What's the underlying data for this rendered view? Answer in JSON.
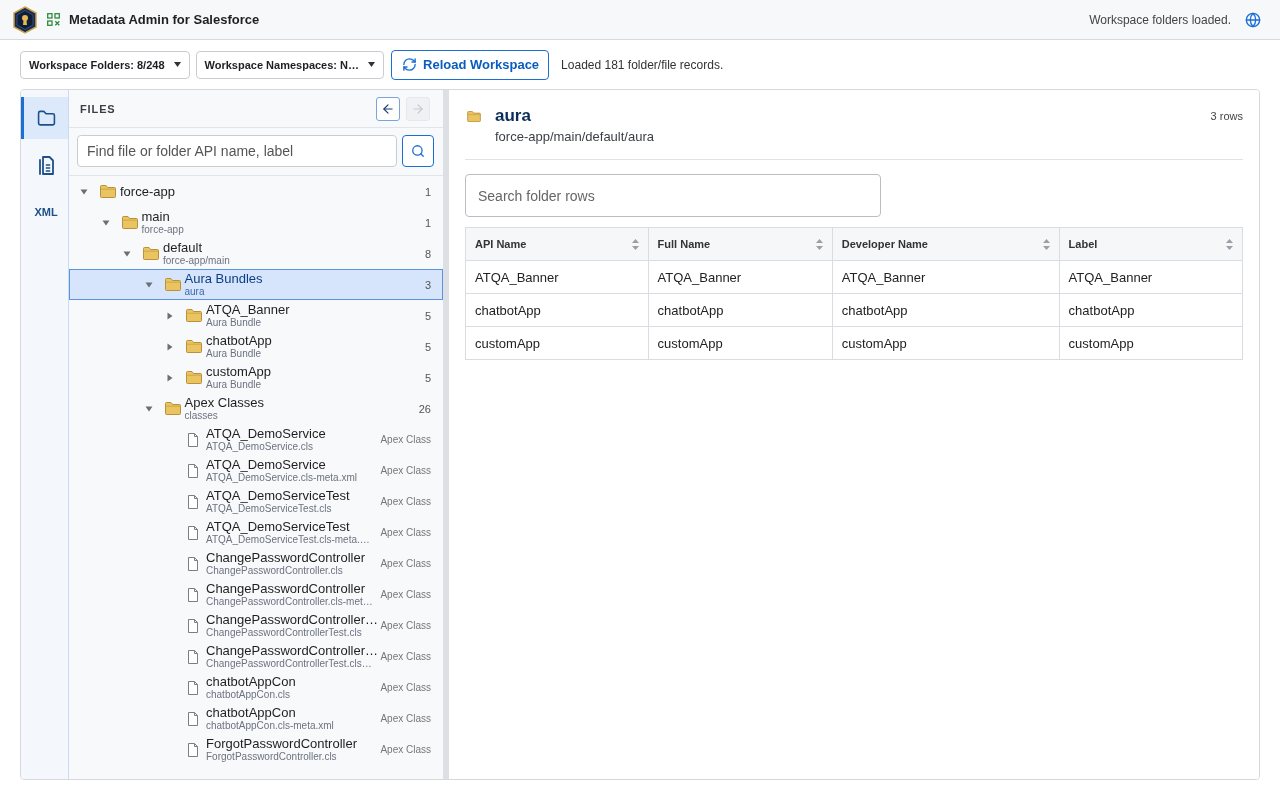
{
  "app_header": {
    "title": "Metadata Admin for Salesforce",
    "status": "Workspace folders loaded."
  },
  "toolbar": {
    "dropdowns": [
      {
        "label": "Workspace Folders: 8/248"
      },
      {
        "label": "Workspace Namespaces: N…"
      }
    ],
    "reload_button": {
      "label": "Reload Workspace"
    },
    "status": "Loaded 181 folder/file records."
  },
  "rail": [
    {
      "kind": "folder",
      "selected": true
    },
    {
      "kind": "document",
      "selected": false
    },
    {
      "kind": "label",
      "label": "XML",
      "selected": false
    }
  ],
  "files_panel": {
    "title": "FILES",
    "nav_buttons": [
      {
        "kind": "back",
        "disabled": false
      },
      {
        "kind": "forward",
        "disabled": true
      }
    ],
    "search": {
      "placeholder": "Find file or folder API name, label"
    },
    "tree": [
      {
        "kind": "folder",
        "name": "force-app",
        "count": "1",
        "expanded": true,
        "selected": false,
        "children": [
          {
            "kind": "folder",
            "name": "main",
            "subtitle": "force-app",
            "count": "1",
            "expanded": true,
            "selected": false,
            "children": [
              {
                "kind": "folder",
                "name": "default",
                "subtitle": "force-app/main",
                "count": "8",
                "expanded": true,
                "selected": false,
                "children": [
                  {
                    "kind": "folder",
                    "name": "Aura Bundles",
                    "subtitle": "aura",
                    "count": "3",
                    "expanded": true,
                    "selected": true,
                    "children": [
                      {
                        "kind": "folder",
                        "name": "ATQA_Banner",
                        "subtitle": "Aura Bundle",
                        "count": "5",
                        "expanded": false,
                        "selected": false
                      },
                      {
                        "kind": "folder",
                        "name": "chatbotApp",
                        "subtitle": "Aura Bundle",
                        "count": "5",
                        "expanded": false,
                        "selected": false
                      },
                      {
                        "kind": "folder",
                        "name": "customApp",
                        "subtitle": "Aura Bundle",
                        "count": "5",
                        "expanded": false,
                        "selected": false
                      }
                    ]
                  },
                  {
                    "kind": "folder",
                    "name": "Apex Classes",
                    "subtitle": "classes",
                    "count": "26",
                    "expanded": true,
                    "selected": false,
                    "children": [
                      {
                        "kind": "file",
                        "name": "ATQA_DemoService",
                        "subtitle": "ATQA_DemoService.cls",
                        "type": "Apex Class",
                        "selected": false
                      },
                      {
                        "kind": "file",
                        "name": "ATQA_DemoService",
                        "subtitle": "ATQA_DemoService.cls-meta.xml",
                        "type": "Apex Class",
                        "selected": false
                      },
                      {
                        "kind": "file",
                        "name": "ATQA_DemoServiceTest",
                        "subtitle": "ATQA_DemoServiceTest.cls",
                        "type": "Apex Class",
                        "selected": false
                      },
                      {
                        "kind": "file",
                        "name": "ATQA_DemoServiceTest",
                        "subtitle": "ATQA_DemoServiceTest.cls-meta.…",
                        "type": "Apex Class",
                        "selected": false
                      },
                      {
                        "kind": "file",
                        "name": "ChangePasswordController",
                        "subtitle": "ChangePasswordController.cls",
                        "type": "Apex Class",
                        "selected": false
                      },
                      {
                        "kind": "file",
                        "name": "ChangePasswordController",
                        "subtitle": "ChangePasswordController.cls-met…",
                        "type": "Apex Class",
                        "selected": false
                      },
                      {
                        "kind": "file",
                        "name": "ChangePasswordController…",
                        "subtitle": "ChangePasswordControllerTest.cls",
                        "type": "Apex Class",
                        "selected": false
                      },
                      {
                        "kind": "file",
                        "name": "ChangePasswordController…",
                        "subtitle": "ChangePasswordControllerTest.cls…",
                        "type": "Apex Class",
                        "selected": false
                      },
                      {
                        "kind": "file",
                        "name": "chatbotAppCon",
                        "subtitle": "chatbotAppCon.cls",
                        "type": "Apex Class",
                        "selected": false
                      },
                      {
                        "kind": "file",
                        "name": "chatbotAppCon",
                        "subtitle": "chatbotAppCon.cls-meta.xml",
                        "type": "Apex Class",
                        "selected": false
                      },
                      {
                        "kind": "file",
                        "name": "ForgotPasswordController",
                        "subtitle": "ForgotPasswordController.cls",
                        "type": "Apex Class",
                        "selected": false
                      }
                    ]
                  }
                ]
              }
            ]
          }
        ]
      }
    ]
  },
  "folder_view": {
    "name": "aura",
    "path": "force-app/main/default/aura",
    "row_count": "3 rows",
    "search": {
      "placeholder": "Search folder rows"
    },
    "table": {
      "columns": [
        "API Name",
        "Full Name",
        "Developer Name",
        "Label"
      ],
      "rows": [
        [
          "ATQA_Banner",
          "ATQA_Banner",
          "ATQA_Banner",
          "ATQA_Banner"
        ],
        [
          "chatbotApp",
          "chatbotApp",
          "chatbotApp",
          "chatbotApp"
        ],
        [
          "customApp",
          "customApp",
          "customApp",
          "customApp"
        ]
      ]
    }
  }
}
